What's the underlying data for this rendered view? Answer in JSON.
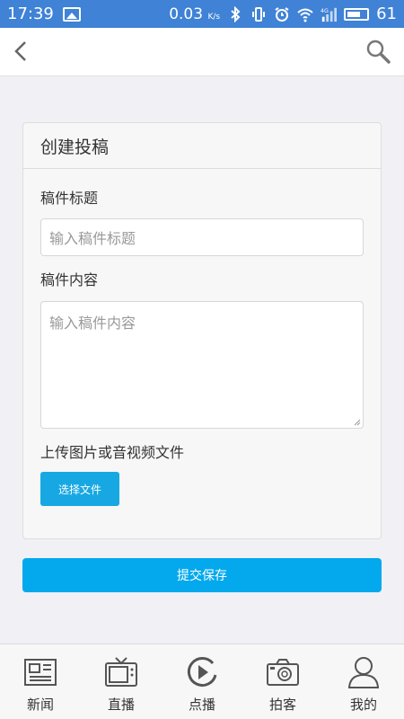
{
  "status_bar": {
    "time": "17:39",
    "net_speed": "0.03",
    "net_unit": "K/s",
    "signal_label": "4G",
    "battery": "61"
  },
  "header": {
    "back_icon": "chevron-left-icon",
    "search_icon": "search-icon"
  },
  "form": {
    "title": "创建投稿",
    "title_label": "稿件标题",
    "title_placeholder": "输入稿件标题",
    "content_label": "稿件内容",
    "content_placeholder": "输入稿件内容",
    "upload_label": "上传图片或音视频文件",
    "choose_file_button": "选择文件"
  },
  "submit_button": "提交保存",
  "nav": {
    "items": [
      {
        "label": "新闻",
        "icon": "newspaper-icon"
      },
      {
        "label": "直播",
        "icon": "tv-icon"
      },
      {
        "label": "点播",
        "icon": "play-icon"
      },
      {
        "label": "拍客",
        "icon": "camera-icon"
      },
      {
        "label": "我的",
        "icon": "user-icon"
      }
    ]
  },
  "colors": {
    "status_bar": "#3f82d6",
    "accent": "#03a9ec",
    "icon": "#555555"
  }
}
